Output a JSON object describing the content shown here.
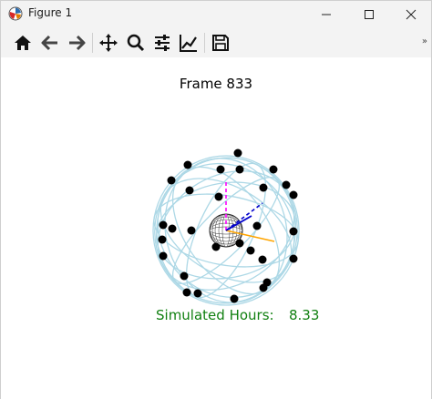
{
  "window": {
    "title": "Figure 1",
    "icons": {
      "app": "matplotlib-icon",
      "minimize": "minimize-icon",
      "maximize": "maximize-icon",
      "close": "close-icon"
    }
  },
  "toolbar": {
    "buttons": [
      {
        "name": "home-button",
        "icon": "home-icon"
      },
      {
        "name": "back-button",
        "icon": "arrow-left-icon"
      },
      {
        "name": "forward-button",
        "icon": "arrow-right-icon"
      },
      {
        "name": "pan-button",
        "icon": "move-icon"
      },
      {
        "name": "zoom-button",
        "icon": "magnifier-icon"
      },
      {
        "name": "subplots-button",
        "icon": "sliders-icon"
      },
      {
        "name": "edit-axes-button",
        "icon": "line-chart-icon"
      },
      {
        "name": "save-button",
        "icon": "floppy-disk-icon"
      }
    ],
    "overflow": "»"
  },
  "figure": {
    "title": "Frame 833",
    "hours_label": "Simulated Hours:",
    "hours_value": "8.33",
    "colors": {
      "orbit": "#add8e6",
      "satellite": "#000000",
      "label": "#118011",
      "axis_x": "#0000cc",
      "axis_y": "#ff00ff",
      "axis_z": "#ffa500"
    }
  }
}
